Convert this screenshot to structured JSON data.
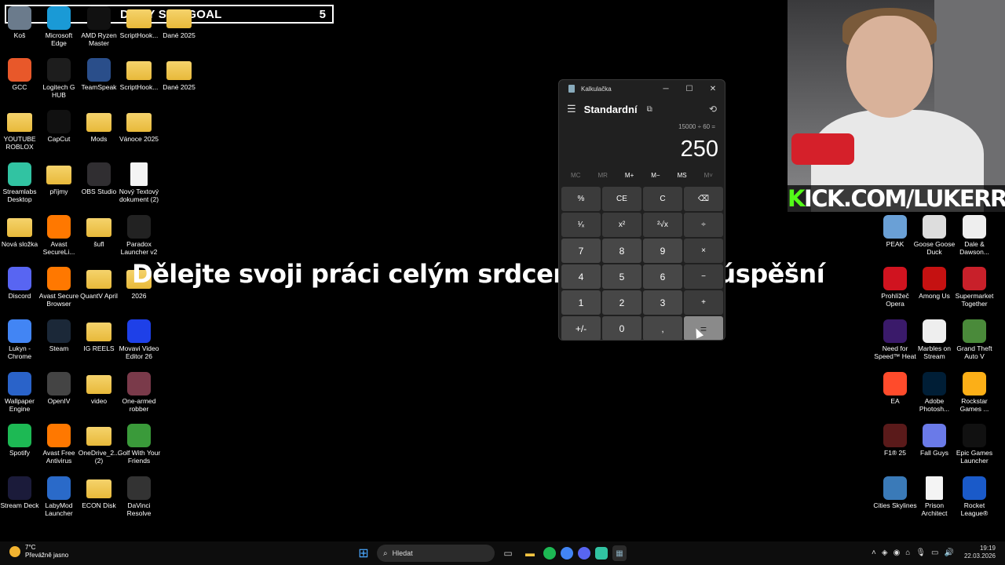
{
  "overlay": {
    "goal_label": "DAILY SUB GOAL",
    "goal_count": "5"
  },
  "quote": "Dělejte svoji práci celým srdcem a budete úspěšní",
  "kick": {
    "k": "K",
    "rest": "ICK.COM/LUKERRIS"
  },
  "desktop_icons": [
    {
      "label": "Koš",
      "icon": "recycle-bin-icon",
      "color": "#6b7b8c"
    },
    {
      "label": "Microsoft Edge",
      "icon": "edge-icon",
      "color": "#1a9ad6"
    },
    {
      "label": "AMD Ryzen Master",
      "icon": "ryzen-icon",
      "color": "#111111"
    },
    {
      "label": "ScriptHook...",
      "icon": "folder-icon",
      "color": "folder"
    },
    {
      "label": "Dané 2025",
      "icon": "folder-icon",
      "color": "folder"
    },
    {
      "label": "GCC",
      "icon": "gcc-icon",
      "color": "#e8582a"
    },
    {
      "label": "Logitech G HUB",
      "icon": "logitech-icon",
      "color": "#1d1d1d"
    },
    {
      "label": "TeamSpeak",
      "icon": "teamspeak-icon",
      "color": "#2a4e8a"
    },
    {
      "label": "ScriptHook...",
      "icon": "folder-icon",
      "color": "folder"
    },
    {
      "label": "Dané 2025",
      "icon": "folder-icon",
      "color": "folder"
    },
    {
      "label": "YOUTUBE ROBLOX",
      "icon": "folder-icon",
      "color": "folder"
    },
    {
      "label": "CapCut",
      "icon": "capcut-icon",
      "color": "#111111"
    },
    {
      "label": "Mods",
      "icon": "folder-icon",
      "color": "folder"
    },
    {
      "label": "Vánoce 2025",
      "icon": "folder-icon",
      "color": "folder"
    },
    {
      "label": "Streamlabs Desktop",
      "icon": "streamlabs-icon",
      "color": "#31c3a2"
    },
    {
      "label": "příjmy",
      "icon": "folder-icon",
      "color": "folder"
    },
    {
      "label": "OBS Studio",
      "icon": "obs-icon",
      "color": "#302e31"
    },
    {
      "label": "Nový Textový dokument (2)",
      "icon": "text-document-icon",
      "color": "doc"
    },
    {
      "label": "Nová složka",
      "icon": "folder-icon",
      "color": "folder"
    },
    {
      "label": "Avast SecureLi...",
      "icon": "avast-secureline-icon",
      "color": "#ff7800"
    },
    {
      "label": "šufl",
      "icon": "folder-icon",
      "color": "folder"
    },
    {
      "label": "Paradox Launcher v2",
      "icon": "paradox-icon",
      "color": "#222222"
    },
    {
      "label": "Discord",
      "icon": "discord-icon",
      "color": "#5865f2"
    },
    {
      "label": "Avast Secure Browser",
      "icon": "avast-browser-icon",
      "color": "#ff7800"
    },
    {
      "label": "QuantV April",
      "icon": "folder-icon",
      "color": "folder"
    },
    {
      "label": "2026",
      "icon": "folder-icon",
      "color": "folder"
    },
    {
      "label": "Lukyn - Chrome",
      "icon": "chrome-icon",
      "color": "#4285f4"
    },
    {
      "label": "Steam",
      "icon": "steam-icon",
      "color": "#1b2838"
    },
    {
      "label": "IG REELS",
      "icon": "folder-icon",
      "color": "folder"
    },
    {
      "label": "Movavi Video Editor 26",
      "icon": "movavi-icon",
      "color": "#1e40e8"
    },
    {
      "label": "Wallpaper Engine",
      "icon": "wallpaper-engine-icon",
      "color": "#2a63c9"
    },
    {
      "label": "OpenIV",
      "icon": "openiv-icon",
      "color": "#444444"
    },
    {
      "label": "video",
      "icon": "folder-icon",
      "color": "folder"
    },
    {
      "label": "One-armed robber",
      "icon": "one-armed-robber-icon",
      "color": "#7a3a4a"
    },
    {
      "label": "Spotify",
      "icon": "spotify-icon",
      "color": "#1db954"
    },
    {
      "label": "Avast Free Antivirus",
      "icon": "avast-antivirus-icon",
      "color": "#ff7800"
    },
    {
      "label": "OneDrive_2... (2)",
      "icon": "folder-icon",
      "color": "folder"
    },
    {
      "label": "Golf With Your Friends",
      "icon": "golf-icon",
      "color": "#3a9a3a"
    },
    {
      "label": "Stream Deck",
      "icon": "stream-deck-icon",
      "color": "#1b1b3a"
    },
    {
      "label": "LabyMod Launcher",
      "icon": "labymod-icon",
      "color": "#2a6ac9"
    },
    {
      "label": "ECON Disk",
      "icon": "folder-icon",
      "color": "folder"
    },
    {
      "label": "DaVinci Resolve",
      "icon": "davinci-icon",
      "color": "#333333"
    },
    {
      "label": "PEAK",
      "icon": "peak-icon",
      "color": "#6aa0d6"
    },
    {
      "label": "Goose Goose Duck",
      "icon": "goose-icon",
      "color": "#dddddd"
    },
    {
      "label": "Dale & Dawson...",
      "icon": "dale-dawson-icon",
      "color": "#eeeeee"
    },
    {
      "label": "Prohlížeč Opera",
      "icon": "opera-icon",
      "color": "#d0131f"
    },
    {
      "label": "Among Us",
      "icon": "among-us-icon",
      "color": "#c51111"
    },
    {
      "label": "Supermarket Together",
      "icon": "supermarket-icon",
      "color": "#c8202a"
    },
    {
      "label": "Need for Speed™ Heat",
      "icon": "nfs-icon",
      "color": "#3a1a6a"
    },
    {
      "label": "Marbles on Stream",
      "icon": "marbles-icon",
      "color": "#eeeeee"
    },
    {
      "label": "Grand Theft Auto V",
      "icon": "gta-icon",
      "color": "#4a8a3a"
    },
    {
      "label": "EA",
      "icon": "ea-icon",
      "color": "#ff4b2b"
    },
    {
      "label": "Adobe Photosh...",
      "icon": "photoshop-icon",
      "color": "#001e36"
    },
    {
      "label": "Rockstar Games ...",
      "icon": "rockstar-icon",
      "color": "#fcaf17"
    },
    {
      "label": "F1® 25",
      "icon": "f1-icon",
      "color": "#5a1a1a"
    },
    {
      "label": "Fall Guys",
      "icon": "fall-guys-icon",
      "color": "#6a7ae8"
    },
    {
      "label": "Epic Games Launcher",
      "icon": "epic-icon",
      "color": "#111111"
    },
    {
      "label": "Cities Skylines",
      "icon": "cities-icon",
      "color": "#3a7ab8"
    },
    {
      "label": "Prison Architect",
      "icon": "prison-architect-icon",
      "color": "doc"
    },
    {
      "label": "Rocket League®",
      "icon": "rocket-league-icon",
      "color": "#1a5ac9"
    }
  ],
  "calculator": {
    "window_title": "Kalkulačka",
    "mode": "Standardní",
    "expression": "15000 ÷ 60 =",
    "result": "250",
    "memory": [
      {
        "label": "MC",
        "enabled": false
      },
      {
        "label": "MR",
        "enabled": false
      },
      {
        "label": "M+",
        "enabled": true
      },
      {
        "label": "M−",
        "enabled": true
      },
      {
        "label": "MS",
        "enabled": true
      },
      {
        "label": "M˅",
        "enabled": false
      }
    ],
    "keys": [
      {
        "label": "%",
        "kind": "fn",
        "name": "percent-key"
      },
      {
        "label": "CE",
        "kind": "fn",
        "name": "clear-entry-key"
      },
      {
        "label": "C",
        "kind": "fn",
        "name": "clear-key"
      },
      {
        "label": "⌫",
        "kind": "fn",
        "name": "backspace-key"
      },
      {
        "label": "¹⁄ₓ",
        "kind": "fn",
        "name": "reciprocal-key"
      },
      {
        "label": "x²",
        "kind": "fn",
        "name": "square-key"
      },
      {
        "label": "²√x",
        "kind": "fn",
        "name": "square-root-key"
      },
      {
        "label": "÷",
        "kind": "fn",
        "name": "divide-key"
      },
      {
        "label": "7",
        "kind": "num",
        "name": "digit-7-key"
      },
      {
        "label": "8",
        "kind": "num",
        "name": "digit-8-key"
      },
      {
        "label": "9",
        "kind": "num",
        "name": "digit-9-key"
      },
      {
        "label": "×",
        "kind": "fn",
        "name": "multiply-key"
      },
      {
        "label": "4",
        "kind": "num",
        "name": "digit-4-key"
      },
      {
        "label": "5",
        "kind": "num",
        "name": "digit-5-key"
      },
      {
        "label": "6",
        "kind": "num",
        "name": "digit-6-key"
      },
      {
        "label": "−",
        "kind": "fn",
        "name": "subtract-key"
      },
      {
        "label": "1",
        "kind": "num",
        "name": "digit-1-key"
      },
      {
        "label": "2",
        "kind": "num",
        "name": "digit-2-key"
      },
      {
        "label": "3",
        "kind": "num",
        "name": "digit-3-key"
      },
      {
        "label": "+",
        "kind": "fn",
        "name": "add-key"
      },
      {
        "label": "+/-",
        "kind": "num",
        "name": "negate-key"
      },
      {
        "label": "0",
        "kind": "num",
        "name": "digit-0-key"
      },
      {
        "label": ",",
        "kind": "num",
        "name": "decimal-key"
      },
      {
        "label": "=",
        "kind": "eq",
        "name": "equals-key"
      }
    ]
  },
  "taskbar": {
    "weather_temp": "7°C",
    "weather_desc": "Převážně jasno",
    "search_placeholder": "Hledat",
    "time": "19:19",
    "date": "22.03.2026"
  }
}
